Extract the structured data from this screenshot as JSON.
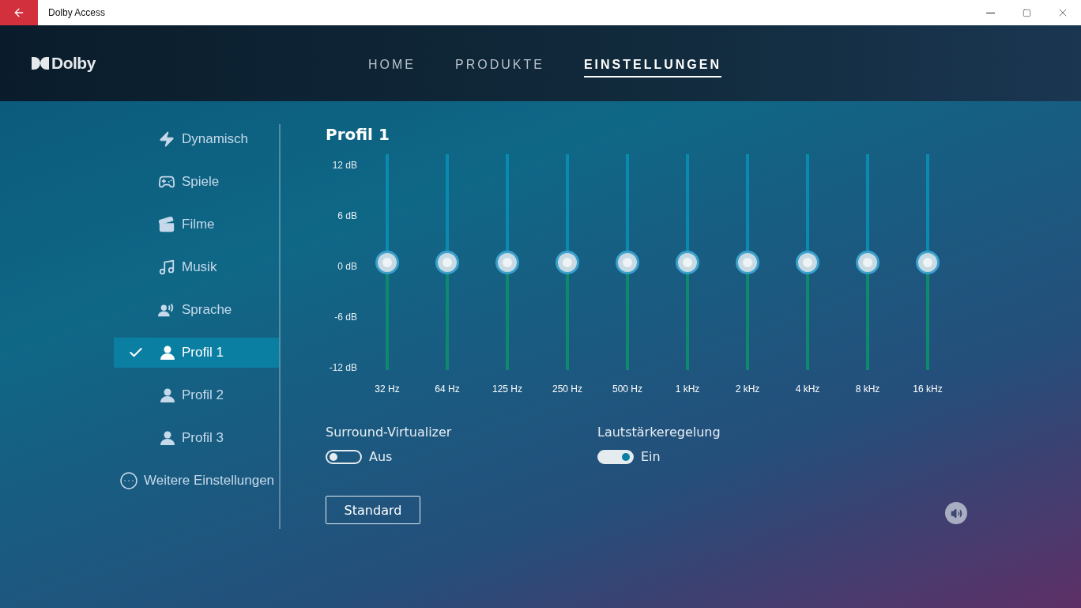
{
  "window": {
    "title": "Dolby Access"
  },
  "header": {
    "logo": "Dolby",
    "nav": [
      {
        "label": "HOME",
        "selected": false
      },
      {
        "label": "PRODUKTE",
        "selected": false
      },
      {
        "label": "EINSTELLUNGEN",
        "selected": true
      }
    ]
  },
  "sidebar": {
    "items": [
      {
        "kind": "bolt",
        "label": "Dynamisch",
        "selected": false
      },
      {
        "kind": "gamepad",
        "label": "Spiele",
        "selected": false
      },
      {
        "kind": "film",
        "label": "Filme",
        "selected": false
      },
      {
        "kind": "music",
        "label": "Musik",
        "selected": false
      },
      {
        "kind": "voice",
        "label": "Sprache",
        "selected": false
      },
      {
        "kind": "profile",
        "label": "Profil 1",
        "selected": true
      },
      {
        "kind": "profile",
        "label": "Profil 2",
        "selected": false
      },
      {
        "kind": "profile",
        "label": "Profil 3",
        "selected": false
      },
      {
        "kind": "more",
        "label": "Weitere Einstellungen",
        "selected": false
      }
    ]
  },
  "equalizer": {
    "title": "Profil 1",
    "scale": [
      "12 dB",
      "6 dB",
      "0 dB",
      "-6 dB",
      "-12 dB"
    ],
    "bands": [
      {
        "label": "32 Hz",
        "level": 0.5
      },
      {
        "label": "64 Hz",
        "level": 0.5
      },
      {
        "label": "125 Hz",
        "level": 0.5
      },
      {
        "label": "250 Hz",
        "level": 0.5
      },
      {
        "label": "500 Hz",
        "level": 0.5
      },
      {
        "label": "1 kHz",
        "level": 0.5
      },
      {
        "label": "2 kHz",
        "level": 0.5
      },
      {
        "label": "4 kHz",
        "level": 0.5
      },
      {
        "label": "8 kHz",
        "level": 0.5
      },
      {
        "label": "16 kHz",
        "level": 0.5
      }
    ]
  },
  "toggles": [
    {
      "label": "Surround-Virtualizer",
      "on": false,
      "state": "Aus"
    },
    {
      "label": "Lautstärkeregelung",
      "on": true,
      "state": "Ein"
    }
  ],
  "buttons": [
    "Standard"
  ]
}
